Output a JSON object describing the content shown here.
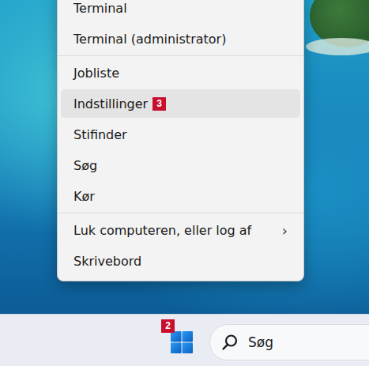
{
  "menu": {
    "groups": [
      [
        {
          "label": "Terminal",
          "selected": false
        },
        {
          "label": "Terminal (administrator)",
          "selected": false
        }
      ],
      [
        {
          "label": "Jobliste",
          "selected": false
        },
        {
          "label": "Indstillinger",
          "selected": true,
          "badge": "3"
        },
        {
          "label": "Stifinder",
          "selected": false
        },
        {
          "label": "Søg",
          "selected": false
        },
        {
          "label": "Kør",
          "selected": false
        }
      ],
      [
        {
          "label": "Luk computeren, eller log af",
          "selected": false,
          "chevron": "›"
        },
        {
          "label": "Skrivebord",
          "selected": false
        }
      ]
    ]
  },
  "taskbar": {
    "start_badge": "2",
    "search": {
      "placeholder": "Søg"
    }
  }
}
